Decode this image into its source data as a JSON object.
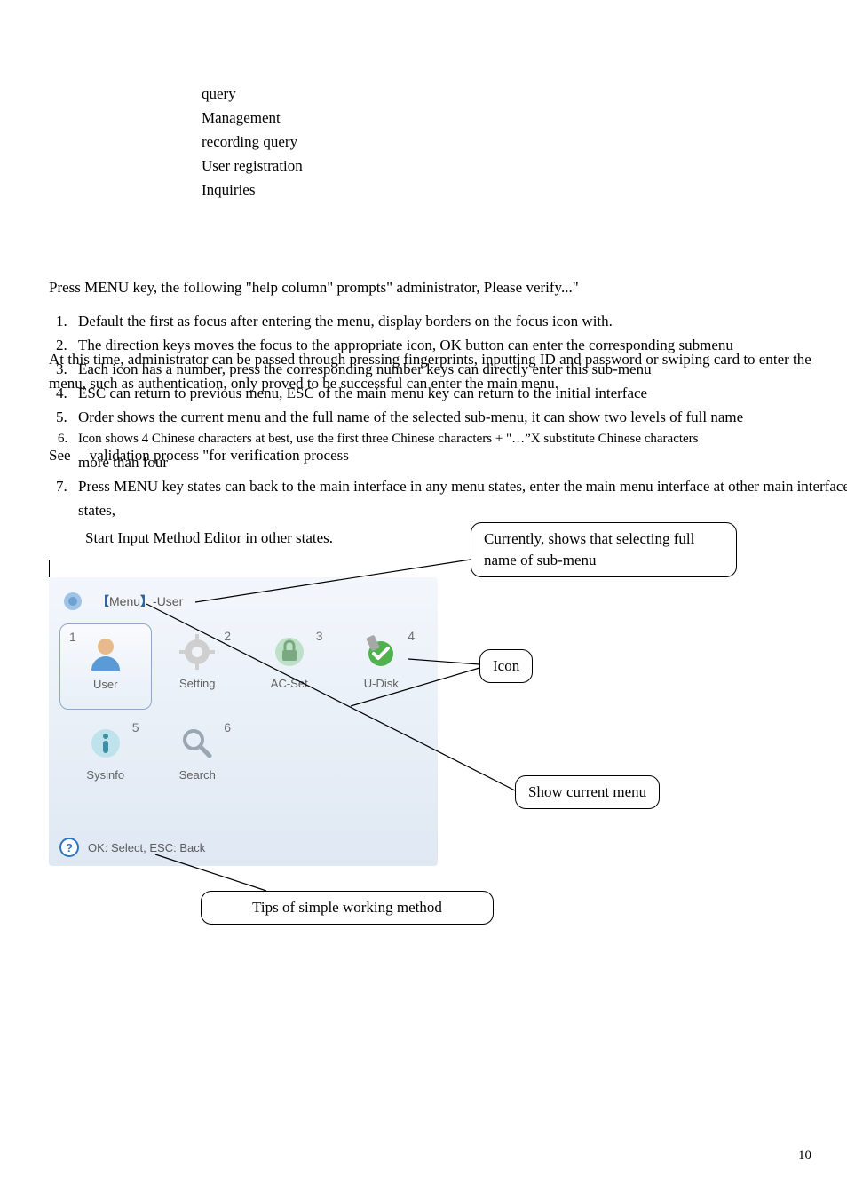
{
  "indent_list": {
    "l1": "query",
    "l2": "Management",
    "l3": "recording query",
    "l4": "User registration",
    "l5": "Inquiries"
  },
  "para": {
    "p1": "Press MENU key, the following \"help column\" prompts\" administrator, Please verify...\"",
    "p2": "At this time, administrator can be passed through pressing fingerprints, inputting ID and password or swiping card to enter the menu, such as authentication, only proved to be successful can enter the main menu.",
    "p3": "See     validation process \"for verification process"
  },
  "list": {
    "i1": "Default the first as focus after entering the menu, display borders on the focus icon with.",
    "i2": "The direction keys moves the focus to the appropriate icon, OK button can enter the corresponding submenu",
    "i3": "Each icon has a number, press the corresponding number keys can directly enter this sub-menu",
    "i4": "ESC can return to previous menu, ESC of the main menu key can return to the initial interface",
    "i5": "Order shows the current menu and the full name of the selected sub-menu, it can show two levels of full name",
    "i6a": "Icon shows 4 Chinese characters at best, use the first three Chinese characters + \"…”X substitute Chinese characters",
    "i6b": "more than four",
    "i7": "Press MENU key states can back to the main interface in any menu states, enter the main menu interface at other main interface states,"
  },
  "start_input": "Start Input Method Editor in other states.",
  "device": {
    "header": {
      "bl": "【",
      "menu": "Menu",
      "br": "】",
      "sub": "-User"
    },
    "cells": {
      "c1": {
        "num": "1",
        "label": "User"
      },
      "c2": {
        "num": "2",
        "label": "Setting"
      },
      "c3": {
        "num": "3",
        "label": "AC-Set"
      },
      "c4": {
        "num": "4",
        "label": "U-Disk"
      },
      "c5": {
        "num": "5",
        "label": "Sysinfo"
      },
      "c6": {
        "num": "6",
        "label": "Search"
      }
    },
    "status": {
      "q": "?",
      "text": "OK: Select, ESC: Back"
    }
  },
  "callouts": {
    "fullname": "Currently, shows that selecting full name of sub-menu",
    "icon": "Icon",
    "current": "Show current menu",
    "tips": "Tips of simple working method"
  },
  "page_number": "10"
}
